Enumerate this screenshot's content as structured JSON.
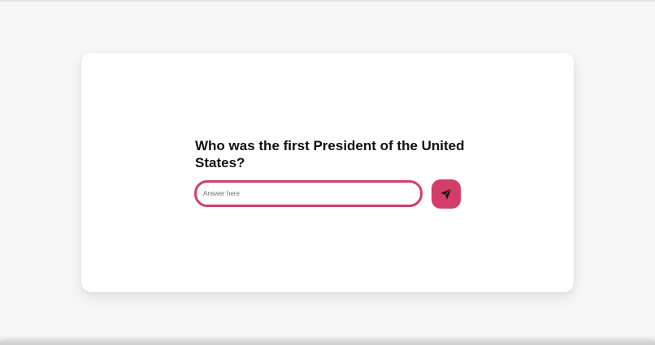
{
  "quiz": {
    "question": "Who was the first President of the United States?",
    "answer_value": "",
    "answer_placeholder": "Answer here",
    "submit_icon": "send-icon"
  },
  "colors": {
    "accent": "#d43d6a",
    "card_background": "#ffffff",
    "page_background": "#f7f7f7",
    "question_text": "#111111"
  }
}
